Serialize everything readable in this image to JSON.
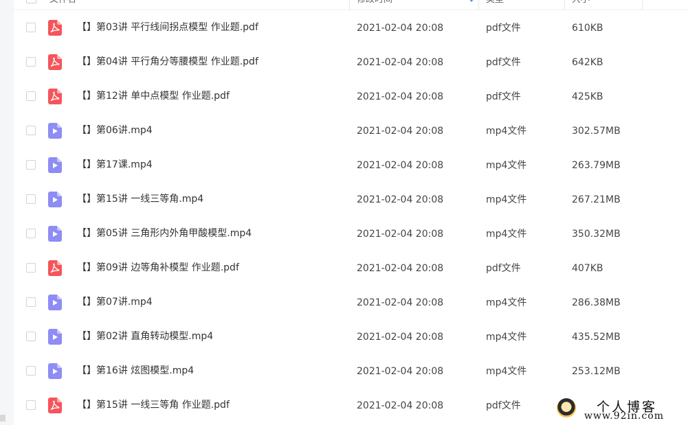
{
  "header": {
    "col_name": "文件名",
    "col_modified": "修改时间",
    "col_type": "类型",
    "col_size": "大小"
  },
  "files": [
    {
      "name": "【】第03讲 平行线间拐点模型 作业题.pdf",
      "modified": "2021-02-04 20:08",
      "type": "pdf文件",
      "size": "610KB",
      "icon": "pdf-icon"
    },
    {
      "name": "【】第04讲 平行角分等腰模型 作业题.pdf",
      "modified": "2021-02-04 20:08",
      "type": "pdf文件",
      "size": "642KB",
      "icon": "pdf-icon"
    },
    {
      "name": "【】第12讲 单中点模型 作业题.pdf",
      "modified": "2021-02-04 20:08",
      "type": "pdf文件",
      "size": "425KB",
      "icon": "pdf-icon"
    },
    {
      "name": "【】第06讲.mp4",
      "modified": "2021-02-04 20:08",
      "type": "mp4文件",
      "size": "302.57MB",
      "icon": "video-icon"
    },
    {
      "name": "【】第17课.mp4",
      "modified": "2021-02-04 20:08",
      "type": "mp4文件",
      "size": "263.79MB",
      "icon": "video-icon"
    },
    {
      "name": "【】第15讲 一线三等角.mp4",
      "modified": "2021-02-04 20:08",
      "type": "mp4文件",
      "size": "267.21MB",
      "icon": "video-icon"
    },
    {
      "name": "【】第05讲 三角形内外角甲酸模型.mp4",
      "modified": "2021-02-04 20:08",
      "type": "mp4文件",
      "size": "350.32MB",
      "icon": "video-icon"
    },
    {
      "name": "【】第09讲 边等角补模型 作业题.pdf",
      "modified": "2021-02-04 20:08",
      "type": "pdf文件",
      "size": "407KB",
      "icon": "pdf-icon"
    },
    {
      "name": "【】第07讲.mp4",
      "modified": "2021-02-04 20:08",
      "type": "mp4文件",
      "size": "286.38MB",
      "icon": "video-icon"
    },
    {
      "name": "【】第02讲 直角转动模型.mp4",
      "modified": "2021-02-04 20:08",
      "type": "mp4文件",
      "size": "435.52MB",
      "icon": "video-icon"
    },
    {
      "name": "【】第16讲 炫图模型.mp4",
      "modified": "2021-02-04 20:08",
      "type": "mp4文件",
      "size": "253.12MB",
      "icon": "video-icon"
    },
    {
      "name": "【】第15讲 一线三等角 作业题.pdf",
      "modified": "2021-02-04 20:08",
      "type": "pdf文件",
      "size": "",
      "icon": "pdf-icon"
    }
  ],
  "watermark": {
    "title": "个人博客",
    "url": "www.92in.com"
  },
  "colors": {
    "pdf": "#f4555b",
    "video": "#8e8cf5"
  }
}
